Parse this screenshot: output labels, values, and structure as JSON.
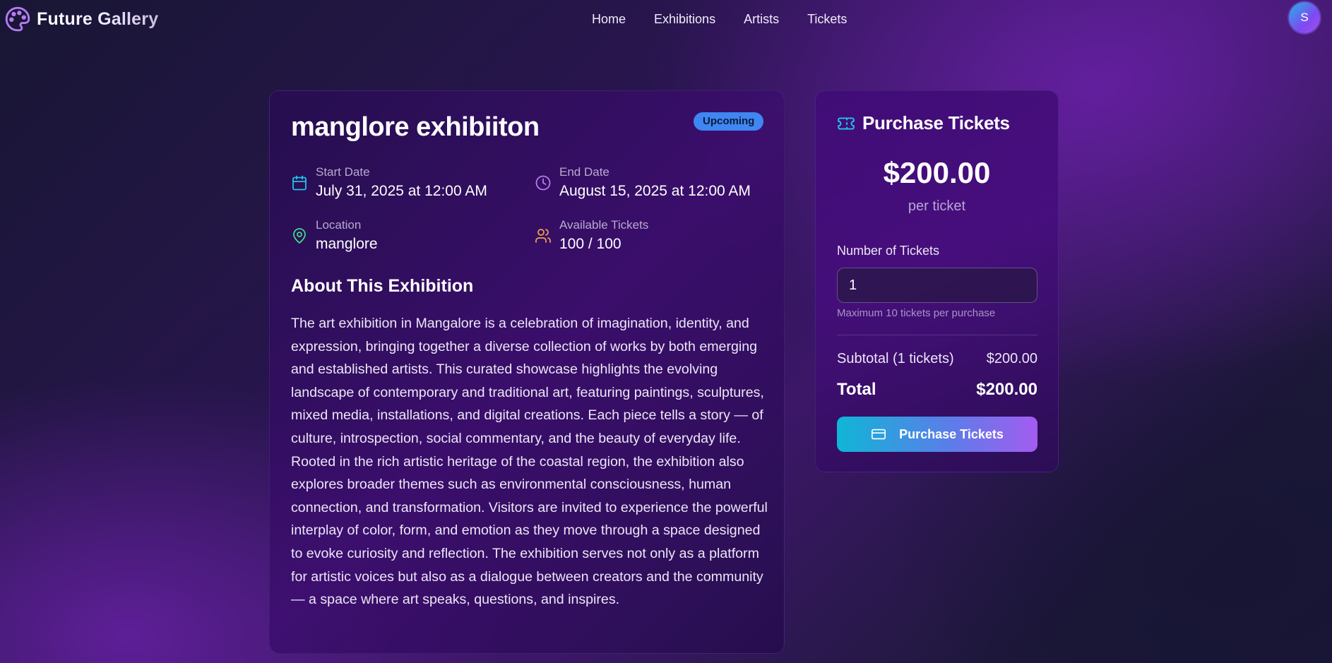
{
  "nav": {
    "brand": "Future Gallery",
    "brand_icon": "palette-icon",
    "links": [
      "Home",
      "Exhibitions",
      "Artists",
      "Tickets"
    ],
    "avatar_initial": "S"
  },
  "exhibition": {
    "title": "manglore exhibiiton",
    "status": "Upcoming",
    "start": {
      "label": "Start Date",
      "value": "July 31, 2025 at 12:00 AM",
      "icon": "calendar-icon",
      "icon_color": "#22c5e8"
    },
    "end": {
      "label": "End Date",
      "value": "August 15, 2025 at 12:00 AM",
      "icon": "clock-icon",
      "icon_color": "#b57cf5"
    },
    "location": {
      "label": "Location",
      "value": "manglore",
      "icon": "map-pin-icon",
      "icon_color": "#3fd98a"
    },
    "tickets": {
      "label": "Available Tickets",
      "value": "100 / 100",
      "icon": "users-icon",
      "icon_color": "#f0a050"
    },
    "about_heading": "About This Exhibition",
    "about_text": "The art exhibition in Mangalore is a celebration of imagination, identity, and expression, bringing together a diverse collection of works by both emerging and established artists. This curated showcase highlights the evolving landscape of contemporary and traditional art, featuring paintings, sculptures, mixed media, installations, and digital creations. Each piece tells a story — of culture, introspection, social commentary, and the beauty of everyday life. Rooted in the rich artistic heritage of the coastal region, the exhibition also explores broader themes such as environmental consciousness, human connection, and transformation. Visitors are invited to experience the powerful interplay of color, form, and emotion as they move through a space designed to evoke curiosity and reflection. The exhibition serves not only as a platform for artistic voices but also as a dialogue between creators and the community — a space where art speaks, questions, and inspires."
  },
  "purchase": {
    "title": "Purchase Tickets",
    "icon": "ticket-icon",
    "price": "$200.00",
    "per_ticket": "per ticket",
    "qty_label": "Number of Tickets",
    "qty_value": "1",
    "qty_hint": "Maximum 10 tickets per purchase",
    "subtotal_label": "Subtotal (1 tickets)",
    "subtotal_value": "$200.00",
    "total_label": "Total",
    "total_value": "$200.00",
    "button_label": "Purchase Tickets",
    "button_icon": "credit-card-icon"
  },
  "colors": {
    "badge": "#3f86f2",
    "button_gradient_start": "#0fb6d6",
    "button_gradient_end": "#a35cf0"
  }
}
